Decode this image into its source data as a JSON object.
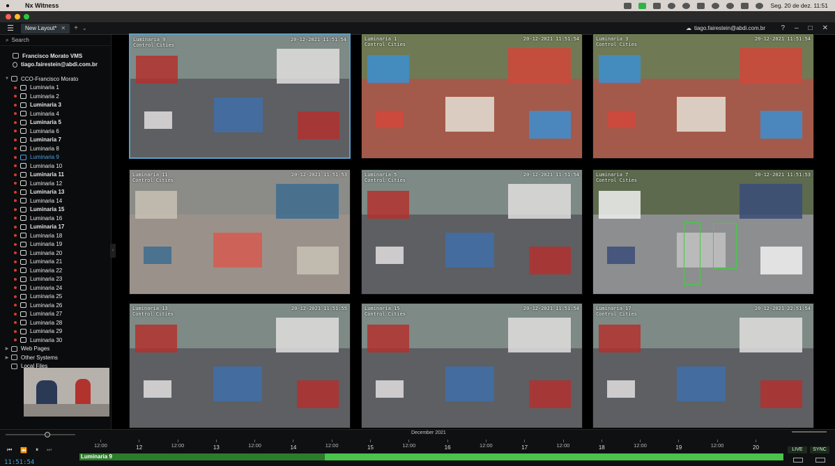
{
  "macbar": {
    "app_name": "Nx Witness",
    "datetime": "Seg. 20 de dez.  11:51"
  },
  "header": {
    "tab_label": "New Layout*",
    "account": "tiago.fairestein@abdi.com.br",
    "help": "?",
    "win_min": "–",
    "win_max": "□",
    "win_close": "✕"
  },
  "sidebar": {
    "search_placeholder": "Search",
    "server": "Francisco Morato VMS",
    "user": "tiago.fairestein@abdi.com.br",
    "group": "CCO-Francisco Morato",
    "cameras": [
      {
        "label": "Luminaria 1",
        "bold": false,
        "rec": true
      },
      {
        "label": "Luminaria 2",
        "bold": false,
        "rec": true
      },
      {
        "label": "Luminaria 3",
        "bold": true,
        "rec": true
      },
      {
        "label": "Luminaria 4",
        "bold": false,
        "rec": true
      },
      {
        "label": "Luminaria 5",
        "bold": true,
        "rec": true
      },
      {
        "label": "Luminaria 6",
        "bold": false,
        "rec": true
      },
      {
        "label": "Luminaria 7",
        "bold": true,
        "rec": true
      },
      {
        "label": "Luminaria 8",
        "bold": false,
        "rec": true
      },
      {
        "label": "Luminaria 9",
        "bold": false,
        "rec": true,
        "active": true
      },
      {
        "label": "Luminaria 10",
        "bold": false,
        "rec": true
      },
      {
        "label": "Luminaria 11",
        "bold": true,
        "rec": true
      },
      {
        "label": "Luminaria 12",
        "bold": false,
        "rec": true
      },
      {
        "label": "Luminaria 13",
        "bold": true,
        "rec": true
      },
      {
        "label": "Luminaria 14",
        "bold": false,
        "rec": true
      },
      {
        "label": "Luminaria 15",
        "bold": true,
        "rec": true
      },
      {
        "label": "Luminaria 16",
        "bold": false,
        "rec": true
      },
      {
        "label": "Luminaria 17",
        "bold": true,
        "rec": true
      },
      {
        "label": "Luminaria 18",
        "bold": false,
        "rec": true
      },
      {
        "label": "Luminaria 19",
        "bold": false,
        "rec": true
      },
      {
        "label": "Luminaria 20",
        "bold": false,
        "rec": true
      },
      {
        "label": "Luminaria 21",
        "bold": false,
        "rec": true
      },
      {
        "label": "Luminaria 22",
        "bold": false,
        "rec": true
      },
      {
        "label": "Luminaria 23",
        "bold": false,
        "rec": true
      },
      {
        "label": "Luminaria 24",
        "bold": false,
        "rec": true
      },
      {
        "label": "Luminaria 25",
        "bold": false,
        "rec": true
      },
      {
        "label": "Luminaria 26",
        "bold": false,
        "rec": true
      },
      {
        "label": "Luminaria 27",
        "bold": false,
        "rec": true
      },
      {
        "label": "Luminaria 28",
        "bold": false,
        "rec": true
      },
      {
        "label": "Luminaria 29",
        "bold": false,
        "rec": true
      },
      {
        "label": "Luminaria 30",
        "bold": false,
        "rec": true
      }
    ],
    "web_pages": "Web Pages",
    "other_systems": "Other Systems",
    "local_files": "Local Files"
  },
  "tiles": [
    {
      "name": "Luminaria 9",
      "sub": "Control Cities",
      "ts": "20-12-2021 11:51:54",
      "scheme": "street",
      "selected": true
    },
    {
      "name": "Luminaria 1",
      "sub": "Control Cities",
      "ts": "20-12-2021 11:51:54",
      "scheme": "market",
      "selected": false
    },
    {
      "name": "Luminaria 3",
      "sub": "Control Cities",
      "ts": "20-12-2021 11:51:54",
      "scheme": "market",
      "selected": false
    },
    {
      "name": "Luminaria 11",
      "sub": "Control Cities",
      "ts": "20-12-2021 11:51:53",
      "scheme": "sidewalk",
      "selected": false
    },
    {
      "name": "Luminaria 5",
      "sub": "Control Cities",
      "ts": "20-12-2021 11:51:54",
      "scheme": "street",
      "selected": false
    },
    {
      "name": "Luminaria 7",
      "sub": "Control Cities",
      "ts": "20-12-2021 11:51:53",
      "scheme": "crosswalk",
      "selected": false
    },
    {
      "name": "Luminaria 13",
      "sub": "Control Cities",
      "ts": "20-12-2021 11:51:55",
      "scheme": "street",
      "selected": false
    },
    {
      "name": "Luminaria 15",
      "sub": "Control Cities",
      "ts": "20-12-2021 11:51:54",
      "scheme": "street",
      "selected": false
    },
    {
      "name": "Luminaria 17",
      "sub": "Control Cities",
      "ts": "20-12-2021 22:51:54",
      "scheme": "street",
      "selected": false
    }
  ],
  "timeline": {
    "month": "December 2021",
    "ticks": [
      "12:00",
      "12",
      "12:00",
      "13",
      "12:00",
      "14",
      "12:00",
      "15",
      "12:00",
      "16",
      "12:00",
      "17",
      "12:00",
      "18",
      "12:00",
      "19",
      "12:00",
      "20"
    ],
    "camera": "Luminaria 9",
    "clock": "11:51:54",
    "live": "LIVE",
    "sync": "SYNC",
    "prev": "⏮",
    "rew": "⏪",
    "pause": "⏸",
    "next": "⏭"
  }
}
